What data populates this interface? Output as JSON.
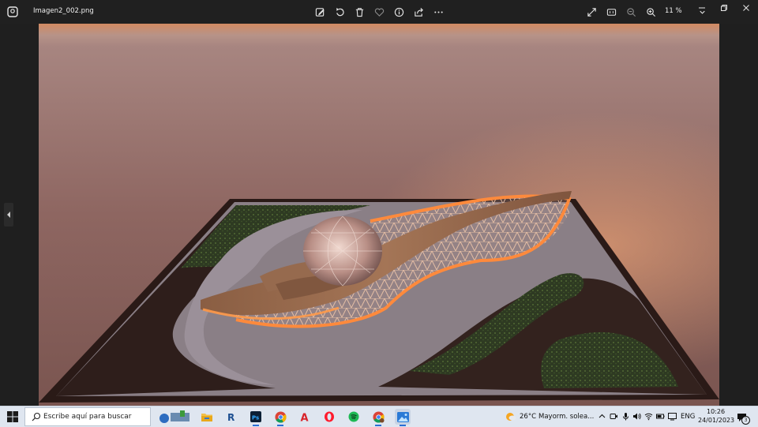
{
  "window": {
    "filename": "Imagen2_002.png",
    "zoom": "11 %",
    "icons": {
      "app": "photos-app-icon",
      "edit": "edit-image-icon",
      "rotate": "rotate-icon",
      "delete": "trash-icon",
      "favorite": "heart-icon",
      "info": "info-icon",
      "share": "share-icon",
      "more": "more-icon",
      "fullscreen": "fullscreen-icon",
      "actual_size": "actual-size-icon",
      "zoom_out": "zoom-out-icon",
      "zoom_in": "zoom-in-icon",
      "minimize": "minimize-icon",
      "restore": "restore-icon",
      "close": "close-icon"
    }
  },
  "viewer": {
    "prev_icon": "chevron-left-icon"
  },
  "taskbar": {
    "search_placeholder": "Escribe aquí para buscar",
    "apps": [
      "search-highlight-icon",
      "file-explorer-icon",
      "revit-icon",
      "photoshop-icon",
      "chrome-icon",
      "acrobat-icon",
      "opera-icon",
      "spotify-icon",
      "chrome-profile-icon",
      "photos-icon"
    ],
    "weather_temp": "26°C",
    "weather_text": "Mayorm. solea...",
    "language": "ENG",
    "time": "10:26",
    "date": "24/01/2023",
    "notification_count": "3"
  }
}
